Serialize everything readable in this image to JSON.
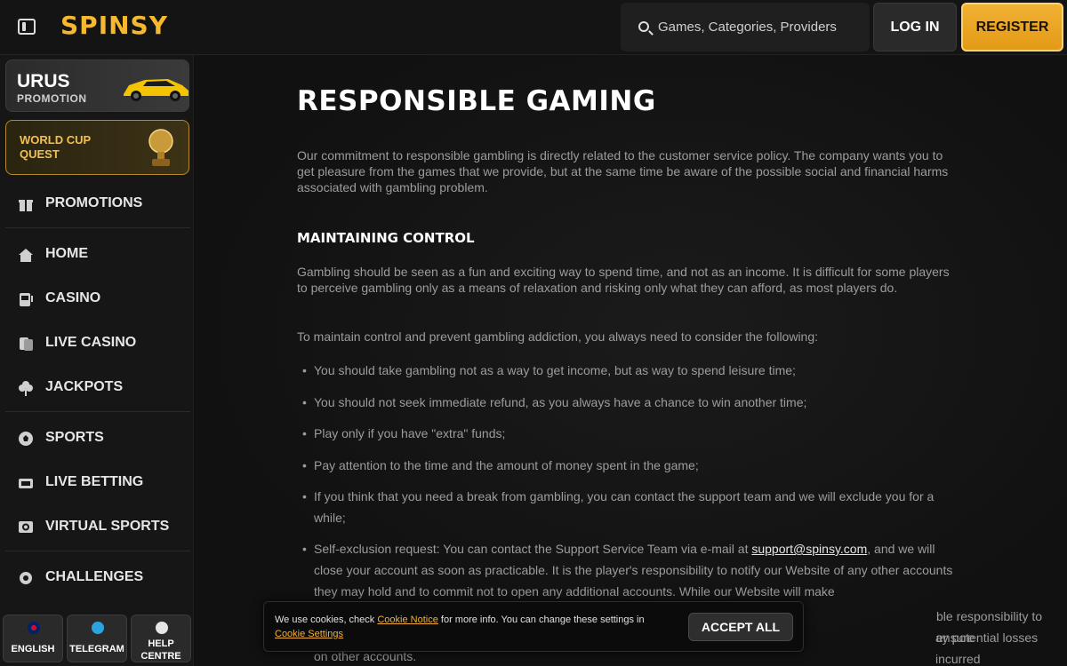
{
  "header": {
    "logo": "SPINSY",
    "search_placeholder": "Games, Categories, Providers",
    "login_label": "LOG IN",
    "register_label": "REGISTER"
  },
  "sidebar": {
    "promo_urus": {
      "title": "URUS",
      "subtitle": "PROMOTION"
    },
    "promo_worldcup": {
      "title": "WORLD CUP QUEST"
    },
    "items": [
      {
        "label": "PROMOTIONS",
        "icon": "gift-icon"
      },
      {
        "label": "HOME",
        "icon": "home-icon"
      },
      {
        "label": "CASINO",
        "icon": "slot-machine-icon"
      },
      {
        "label": "LIVE CASINO",
        "icon": "cards-icon"
      },
      {
        "label": "JACKPOTS",
        "icon": "clover-icon"
      },
      {
        "label": "SPORTS",
        "icon": "ball-icon"
      },
      {
        "label": "LIVE BETTING",
        "icon": "live-icon"
      },
      {
        "label": "VIRTUAL SPORTS",
        "icon": "virtual-icon"
      },
      {
        "label": "CHALLENGES",
        "icon": "gear-icon"
      }
    ],
    "bottom": {
      "english": "ENGLISH",
      "telegram": "TELEGRAM",
      "help_line1": "HELP",
      "help_line2": "CENTRE"
    }
  },
  "content": {
    "title": "RESPONSIBLE GAMING",
    "intro": "Our commitment to responsible gambling is directly related to the customer service policy. The company wants you to get pleasure from the games that we provide, but at the same time be aware of the possible social and financial harms associated with gambling problem.",
    "section_title": "MAINTAINING CONTROL",
    "para1": "Gambling should be seen as a fun and exciting way to spend time, and not as an income. It is difficult for some players to perceive gambling only as a means of relaxation and risking only what they can afford, as most players do.",
    "para2": "To maintain control and prevent gambling addiction, you always need to consider the following:",
    "bullets": [
      "You should take gambling not as a way to get income, but as way to spend leisure time;",
      "You should not seek immediate refund, as you always have a chance to win another time;",
      "Play only if you have \"extra\" funds;",
      "Pay attention to the time and the amount of money spent in the game;",
      "If you think that you need a break from gambling, you can contact the support team and we will exclude you for a while;"
    ],
    "self_exclusion_prefix": "Self-exclusion request: You can contact the Support Service Team via e-mail at ",
    "support_email": "support@spinsy.com",
    "self_exclusion_suffix": ", and we will close your account as soon as practicable. It is the player's responsibility to notify our Website of any other accounts they may hold and to commit not to open any additional accounts. While our Website will make",
    "hidden_line_1": "ble responsibility to ensure",
    "hidden_line_2": "ay potential losses incurred",
    "hidden_line_3": "on other accounts."
  },
  "cookie": {
    "text_1": "We use cookies, check ",
    "link_notice": "Cookie Notice",
    "text_2": " for more info. You can change these settings in ",
    "link_settings": "Cookie Settings",
    "accept_label": "ACCEPT ALL"
  },
  "colors": {
    "accent": "#f2b134",
    "background": "#0f0f0f",
    "sidebar": "#161616"
  }
}
